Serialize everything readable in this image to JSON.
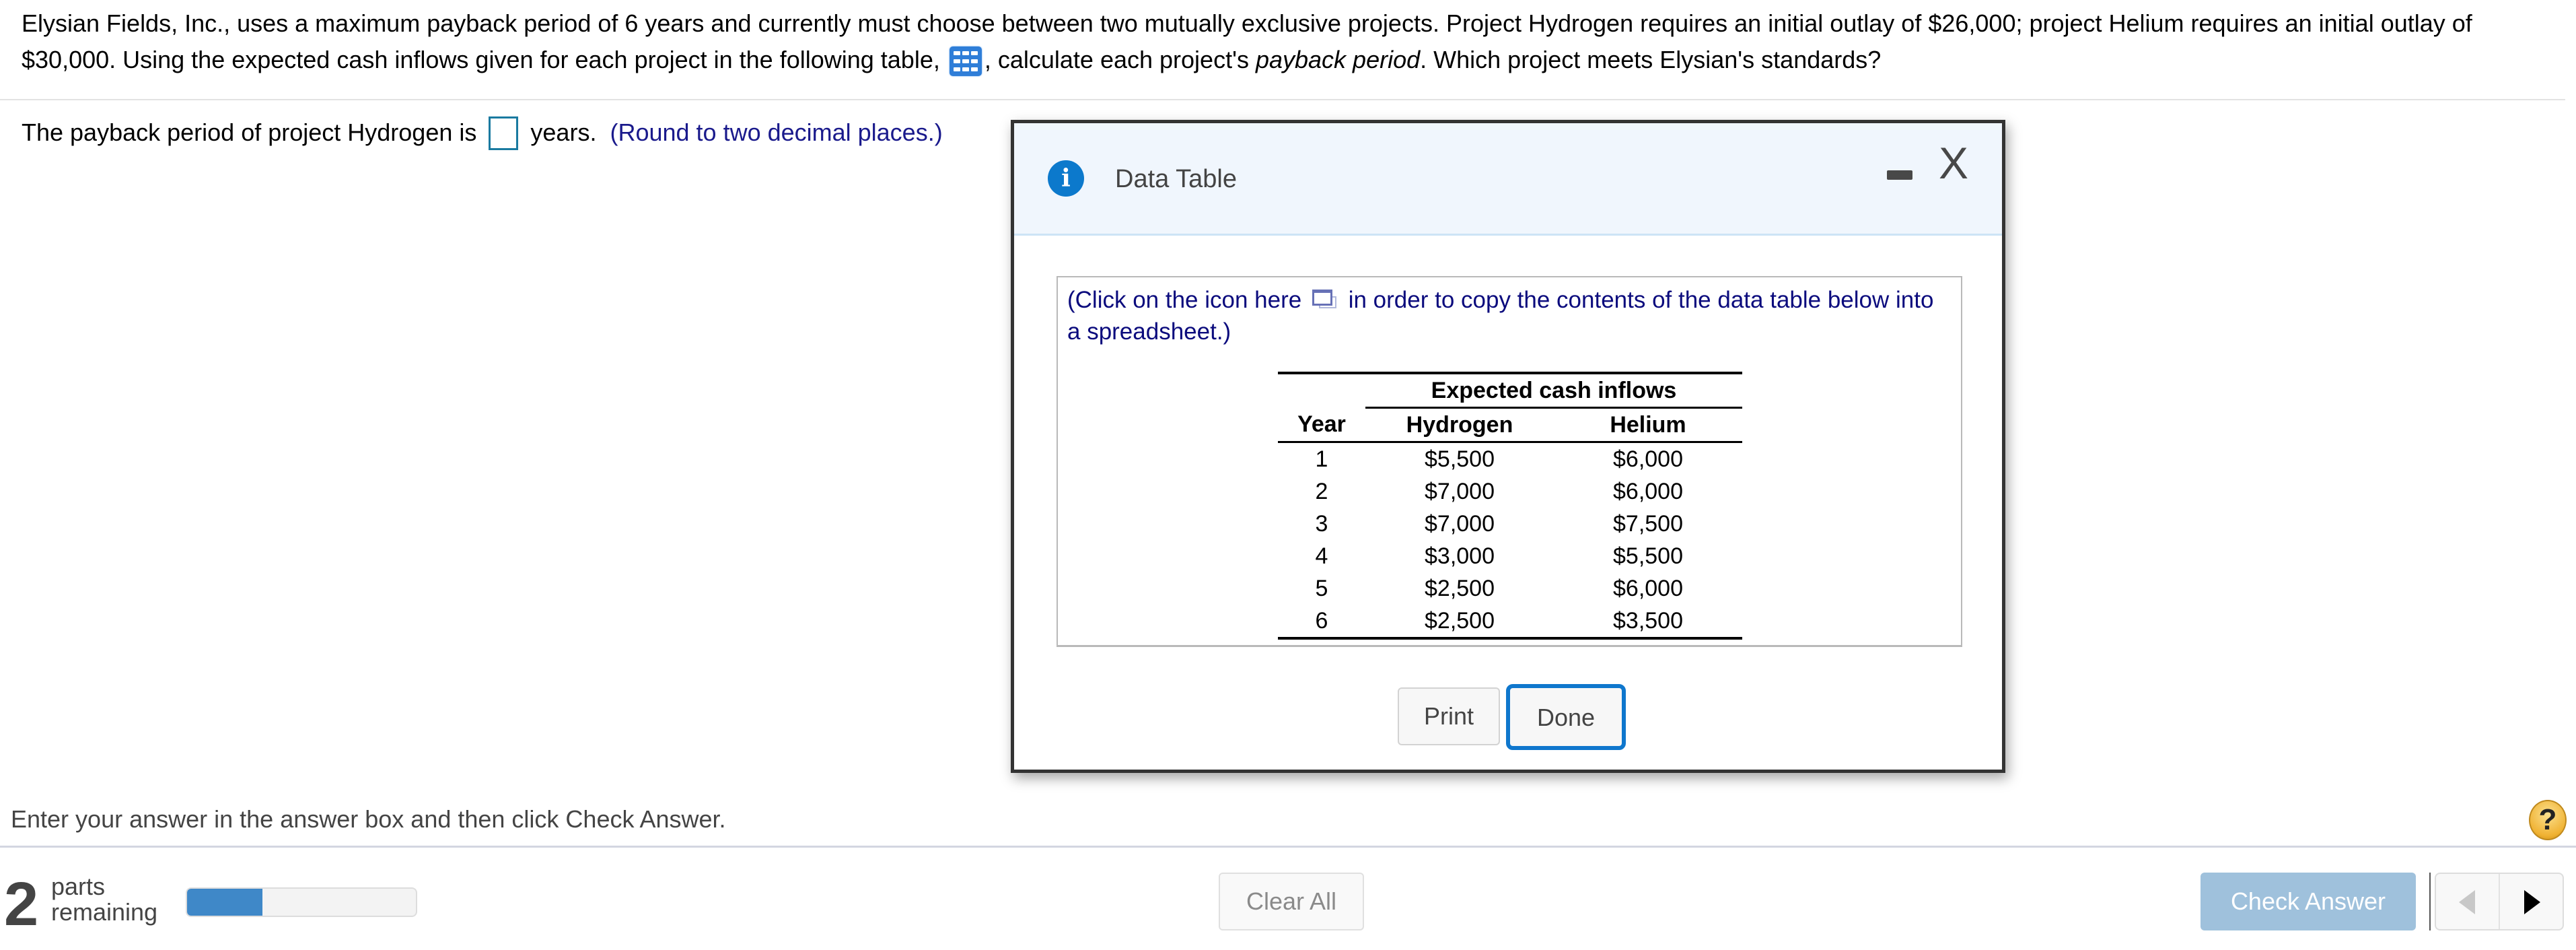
{
  "question": {
    "part1": "Elysian Fields, Inc., uses a maximum payback period of 6 years and currently must choose between two mutually exclusive projects.  Project Hydrogen requires an initial outlay of $26,000; project Helium requires an initial outlay of $30,000.  Using the expected cash inflows given for each project in the following table,",
    "table_icon": "data-table-grid-icon",
    "part2": ", calculate each project's",
    "italic_term": "payback period",
    "part3": ".  Which project meets Elysian's standards?"
  },
  "answer": {
    "prefix": "The payback period of project Hydrogen is",
    "value": "",
    "suffix": "years.",
    "hint": "(Round to two decimal places.)"
  },
  "modal": {
    "title": "Data Table",
    "info_icon": "i",
    "minimize_label": "",
    "close_label": "X",
    "copy_note_prefix": "(Click on the icon here",
    "copy_note_suffix": "in order to copy the contents of the data table below into a spreadsheet.)",
    "table": {
      "group_header": "Expected cash inflows",
      "columns": [
        "Year",
        "Hydrogen",
        "Helium"
      ],
      "rows": [
        {
          "year": "1",
          "hydrogen": "$5,500",
          "helium": "$6,000"
        },
        {
          "year": "2",
          "hydrogen": "$7,000",
          "helium": "$6,000"
        },
        {
          "year": "3",
          "hydrogen": "$7,000",
          "helium": "$7,500"
        },
        {
          "year": "4",
          "hydrogen": "$3,000",
          "helium": "$5,500"
        },
        {
          "year": "5",
          "hydrogen": "$2,500",
          "helium": "$6,000"
        },
        {
          "year": "6",
          "hydrogen": "$2,500",
          "helium": "$3,500"
        }
      ]
    },
    "print_label": "Print",
    "done_label": "Done"
  },
  "footer": {
    "instruction": "Enter your answer in the answer box and then click Check Answer.",
    "help_label": "?",
    "parts_count": "2",
    "parts_label_1": "parts",
    "parts_label_2": "remaining",
    "progress_fraction": 0.33,
    "clear_all_label": "Clear All",
    "check_answer_label": "Check Answer"
  },
  "colors": {
    "accent_blue": "#0f77cd",
    "hint_navy": "#1a1a8c",
    "check_answer_disabled": "#9fc1dc",
    "progress_fill": "#3f88c8",
    "help_gold": "#f0b233"
  }
}
